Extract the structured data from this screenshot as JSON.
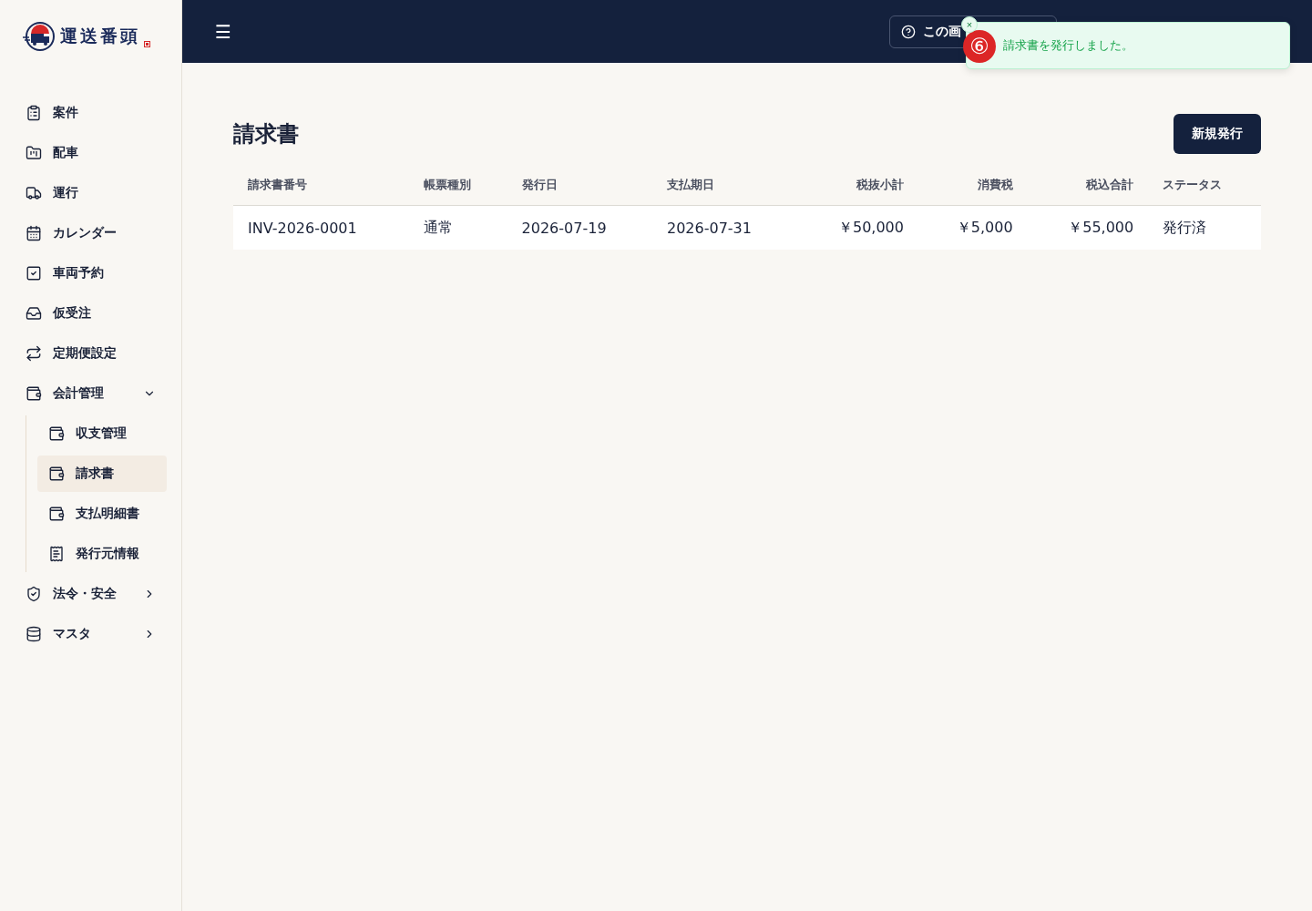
{
  "logo": {
    "text": "運送番頭"
  },
  "header": {
    "menu_glyph": "☰",
    "help_button": "この画"
  },
  "toast": {
    "step_badge": "⑥",
    "close_glyph": "×",
    "message": "請求書を発行しました。"
  },
  "sidebar": {
    "items": [
      {
        "label": "案件",
        "selected": false
      },
      {
        "label": "配車",
        "selected": false
      },
      {
        "label": "運行",
        "selected": false
      },
      {
        "label": "カレンダー",
        "selected": false
      },
      {
        "label": "車両予約",
        "selected": false
      },
      {
        "label": "仮受注",
        "selected": false
      },
      {
        "label": "定期便設定",
        "selected": false
      },
      {
        "label": "会計管理",
        "selected": false,
        "expanded": true,
        "children": [
          {
            "label": "収支管理",
            "selected": false
          },
          {
            "label": "請求書",
            "selected": true
          },
          {
            "label": "支払明細書",
            "selected": false
          },
          {
            "label": "発行元情報",
            "selected": false
          }
        ]
      },
      {
        "label": "法令・安全",
        "selected": false,
        "expanded": false
      },
      {
        "label": "マスタ",
        "selected": false,
        "expanded": false
      }
    ]
  },
  "page": {
    "title": "請求書",
    "new_button": "新規発行"
  },
  "table": {
    "columns": [
      "請求書番号",
      "帳票種別",
      "発行日",
      "支払期日",
      "税抜小計",
      "消費税",
      "税込合計",
      "ステータス"
    ],
    "rows": [
      [
        "INV-2026-0001",
        "通常",
        "2026-07-19",
        "2026-07-31",
        "￥50,000",
        "￥5,000",
        "￥55,000",
        "発行済"
      ]
    ]
  }
}
